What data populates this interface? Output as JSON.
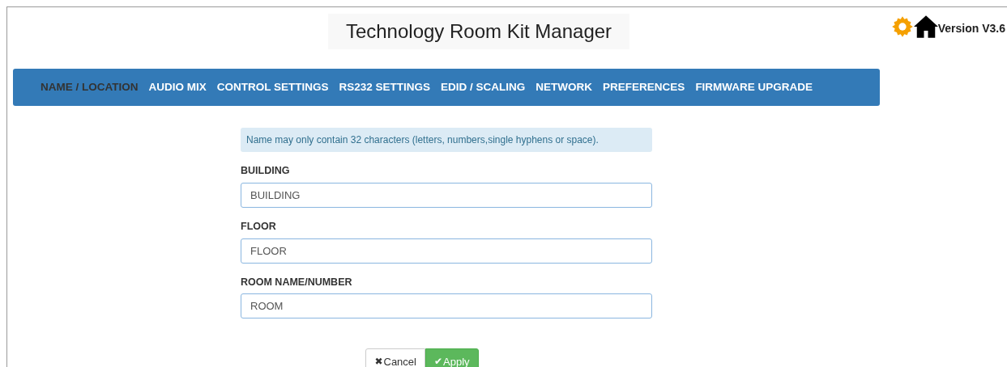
{
  "header": {
    "title": "Technology Room Kit Manager",
    "version": "Version V3.6"
  },
  "tabs": [
    {
      "label": "NAME / LOCATION",
      "selected": true
    },
    {
      "label": "AUDIO MIX",
      "selected": false
    },
    {
      "label": "CONTROL SETTINGS",
      "selected": false
    },
    {
      "label": "RS232 SETTINGS",
      "selected": false
    },
    {
      "label": "EDID / SCALING",
      "selected": false
    },
    {
      "label": "NETWORK",
      "selected": false
    },
    {
      "label": "PREFERENCES",
      "selected": false
    },
    {
      "label": "FIRMWARE UPGRADE",
      "selected": false
    }
  ],
  "notice": "Name may only contain 32 characters (letters, numbers,single hyphens or space).",
  "fields": [
    {
      "label": "BUILDING",
      "value": "BUILDING"
    },
    {
      "label": "FLOOR",
      "value": "FLOOR"
    },
    {
      "label": "ROOM NAME/NUMBER",
      "value": "ROOM"
    }
  ],
  "buttons": [
    {
      "kind": "cancel",
      "label": "Cancel",
      "icon": "✖"
    },
    {
      "kind": "apply",
      "label": "Apply",
      "icon": "✔"
    }
  ]
}
